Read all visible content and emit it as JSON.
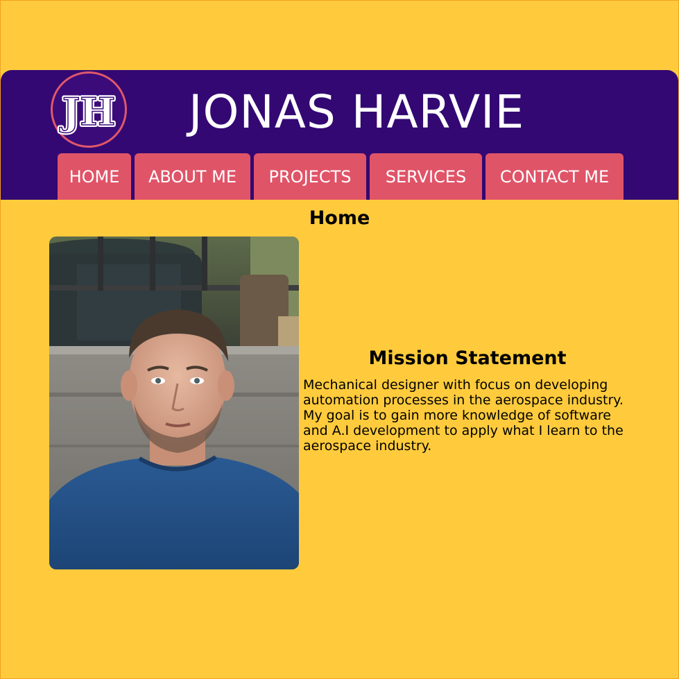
{
  "header": {
    "logo_text": "JH",
    "site_title": "JONAS HARVIE"
  },
  "nav": {
    "items": [
      {
        "label": "HOME"
      },
      {
        "label": "ABOUT ME"
      },
      {
        "label": "PROJECTS"
      },
      {
        "label": "SERVICES"
      },
      {
        "label": "CONTACT ME"
      }
    ]
  },
  "main": {
    "heading": "Home",
    "mission_title": "Mission Statement",
    "mission_text": "Mechanical designer with focus on developing automation processes in the aerospace industry. My goal is to gain more knowledge of software and A.I development to apply what I learn to the aerospace industry."
  },
  "colors": {
    "background": "#ffcb3c",
    "header": "#330873",
    "nav_tab": "#e05468",
    "logo_ring": "#e0586a",
    "text_light": "#ffffff",
    "text_dark": "#000000"
  },
  "icons": {
    "logo": "jh-monogram-logo",
    "portrait": "profile-photo"
  }
}
